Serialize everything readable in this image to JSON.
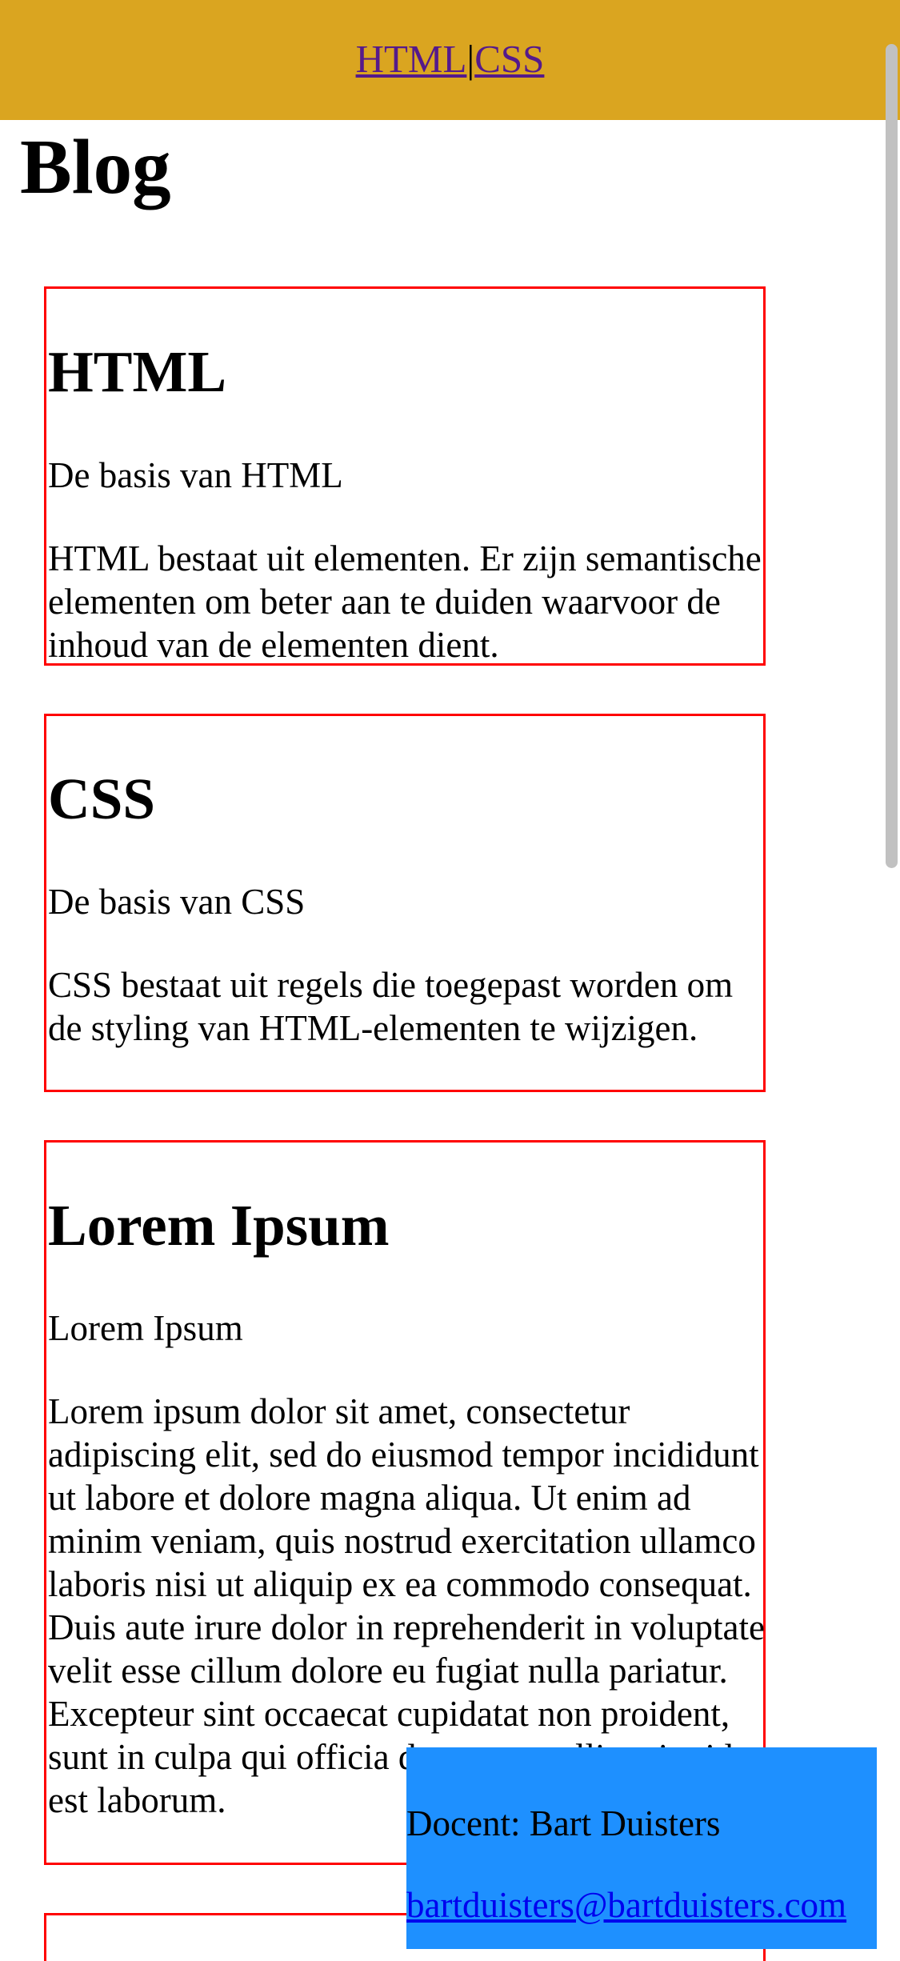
{
  "header": {
    "nav_html": "HTML",
    "nav_separator": "|",
    "nav_css": "CSS",
    "background_color": "#daa520"
  },
  "page": {
    "title": "Blog"
  },
  "articles": [
    {
      "title": "HTML",
      "subtitle": "De basis van HTML",
      "body": "HTML bestaat uit elementen. Er zijn semantische elementen om beter aan te duiden waarvoor de inhoud van de elementen dient."
    },
    {
      "title": "CSS",
      "subtitle": "De basis van CSS",
      "body": "CSS bestaat uit regels die toegepast worden om de styling van HTML-elementen te wijzigen."
    },
    {
      "title": "Lorem Ipsum",
      "subtitle": "Lorem Ipsum",
      "body": "Lorem ipsum dolor sit amet, consectetur adipiscing elit, sed do eiusmod tempor incididunt ut labore et dolore magna aliqua. Ut enim ad minim veniam, quis nostrud exercitation ullamco laboris nisi ut aliquip ex ea commodo consequat. Duis aute irure dolor in reprehenderit in voluptate velit esse cillum dolore eu fugiat nulla pariatur. Excepteur sint occaecat cupidatat non proident, sunt in culpa qui officia deserunt mollit anim id est laborum."
    }
  ],
  "footer": {
    "teacher": "Docent: Bart Duisters",
    "email": "bartduisters@bartduisters.com",
    "background_color": "#1e90ff"
  },
  "colors": {
    "article_border": "#ff0000",
    "link": "#551a8b"
  }
}
